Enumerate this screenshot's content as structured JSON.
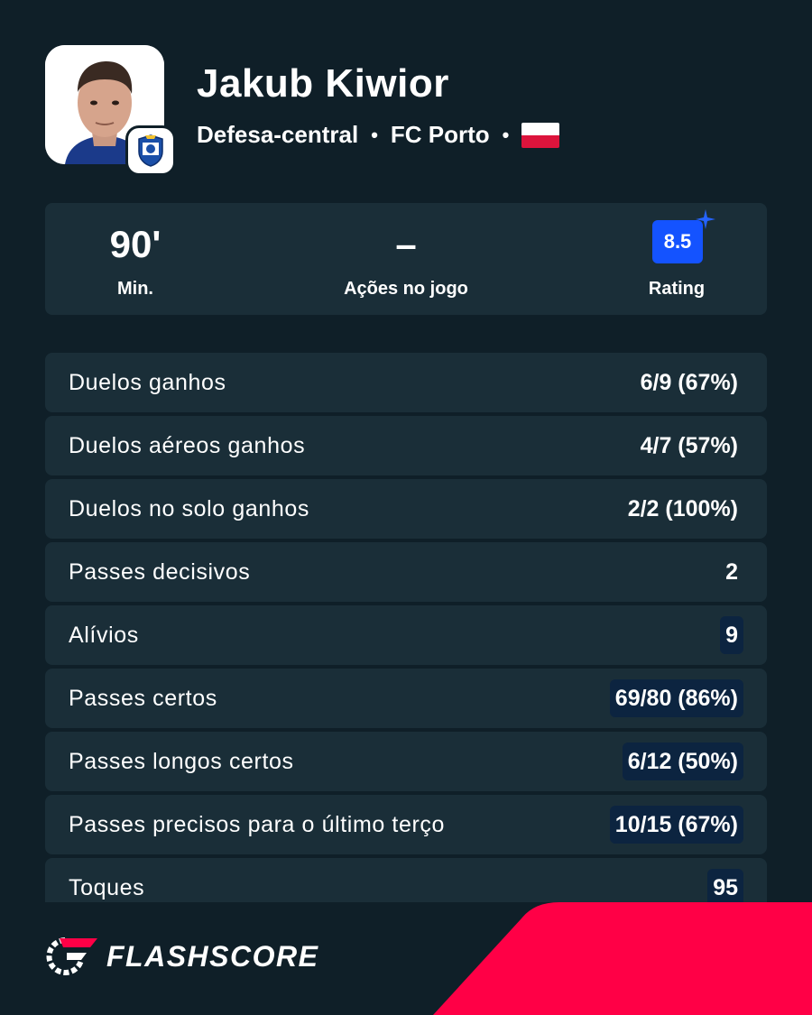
{
  "player": {
    "name": "Jakub Kiwior",
    "position": "Defesa-central",
    "club": "FC Porto",
    "separator": "•",
    "nationality_flag": "flag-icon-poland",
    "club_badge": "fc-porto-crest-icon"
  },
  "summary": {
    "minutes": {
      "value": "90'",
      "label": "Min."
    },
    "actions": {
      "value": "–",
      "label": "Ações no jogo"
    },
    "rating": {
      "value": "8.5",
      "label": "Rating",
      "color": "#1453ff"
    }
  },
  "stats": [
    {
      "label": "Duelos ganhos",
      "value": "6/9 (67%)",
      "highlight": false
    },
    {
      "label": "Duelos aéreos ganhos",
      "value": "4/7 (57%)",
      "highlight": false
    },
    {
      "label": "Duelos no solo ganhos",
      "value": "2/2 (100%)",
      "highlight": false
    },
    {
      "label": "Passes decisivos",
      "value": "2",
      "highlight": false
    },
    {
      "label": "Alívios",
      "value": "9",
      "highlight": true
    },
    {
      "label": "Passes certos",
      "value": "69/80 (86%)",
      "highlight": true
    },
    {
      "label": "Passes longos certos",
      "value": "6/12 (50%)",
      "highlight": true
    },
    {
      "label": "Passes precisos para o último terço",
      "value": "10/15 (67%)",
      "highlight": true
    },
    {
      "label": "Toques",
      "value": "95",
      "highlight": true
    }
  ],
  "brand": {
    "name": "FLASHSCORE",
    "accent": "#ff0046"
  },
  "colors": {
    "background": "#0f1f28",
    "row": "#1a2e38",
    "highlight": "#0c2440"
  }
}
